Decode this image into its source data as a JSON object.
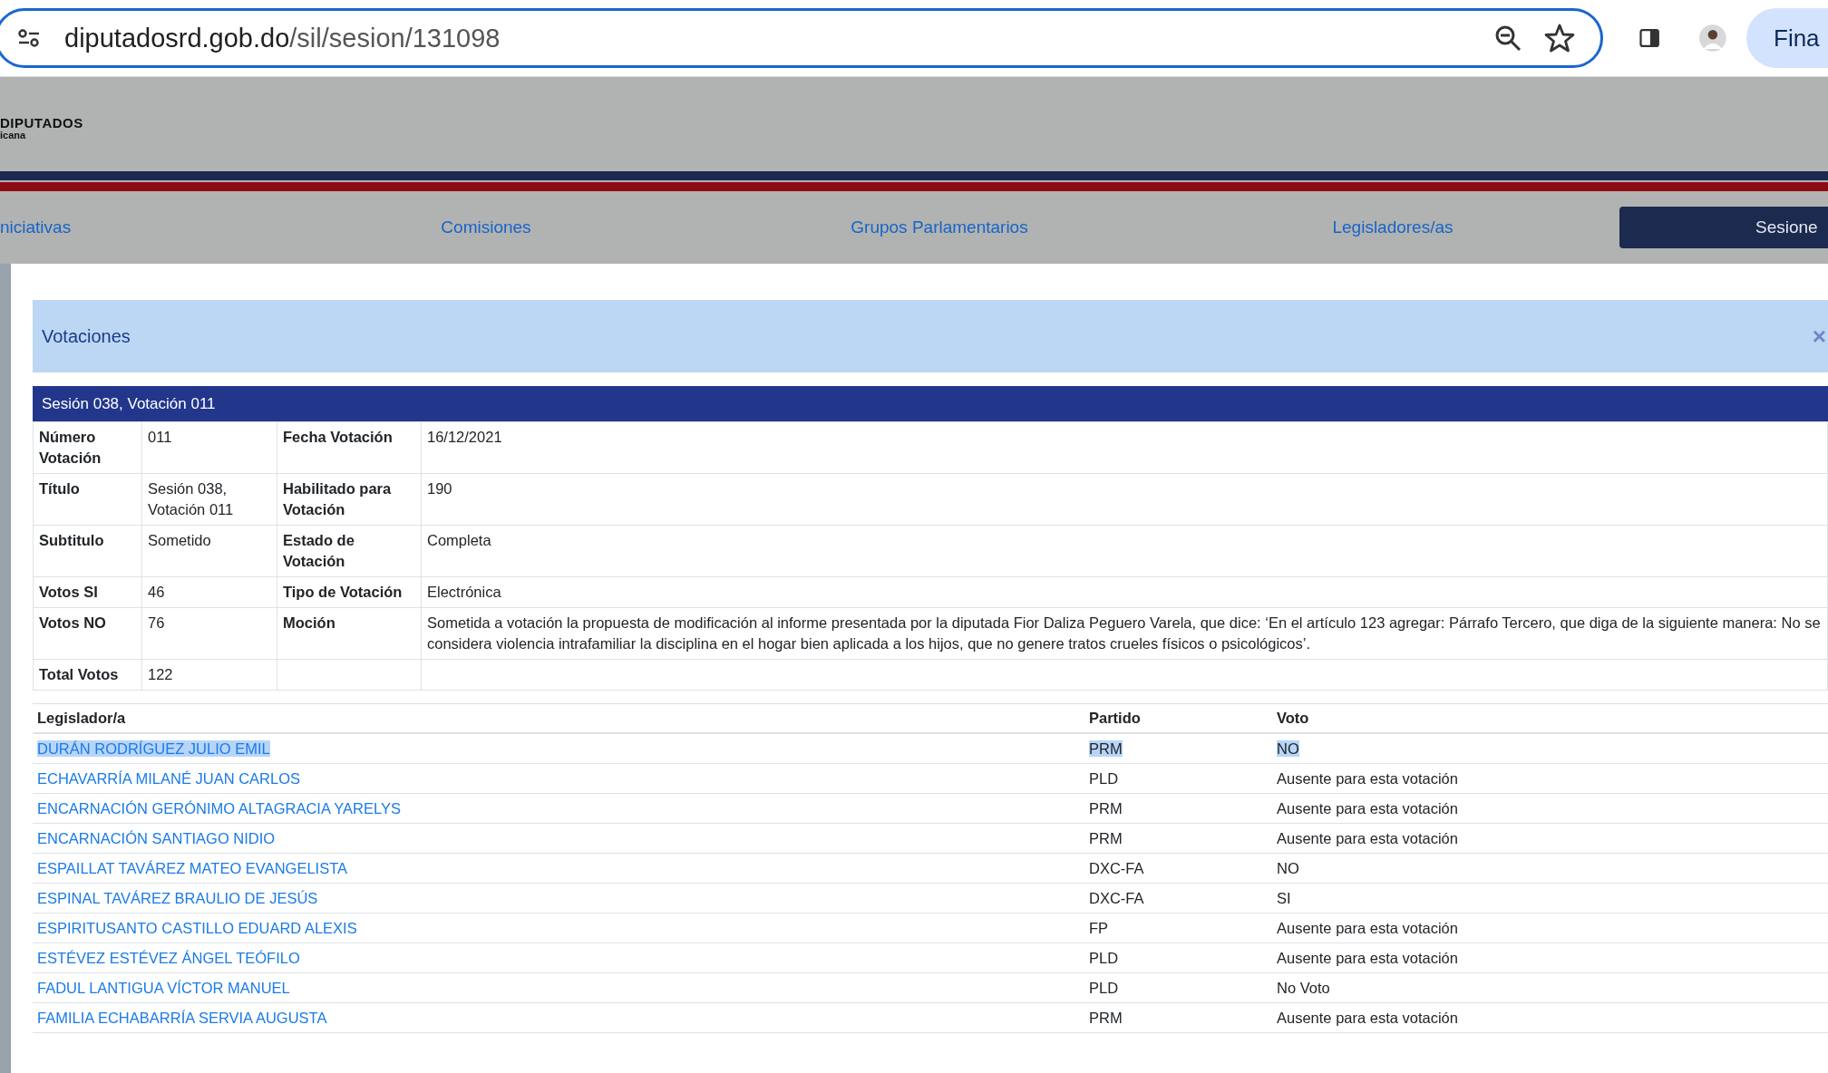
{
  "browser": {
    "url_host": "diputadosrd.gob.do",
    "url_path": "/sil/sesion/131098",
    "button": "Fina"
  },
  "header": {
    "logo_title": "DIPUTADOS",
    "logo_subtitle": "icana"
  },
  "nav": [
    {
      "label": "niciativas",
      "selected": false
    },
    {
      "label": "Comisiones",
      "selected": false
    },
    {
      "label": "Grupos Parlamentarios",
      "selected": false
    },
    {
      "label": "Legisladores/as",
      "selected": false
    },
    {
      "label": "Sesione",
      "selected": true
    }
  ],
  "modal": {
    "title": "Votaciones",
    "close": "×",
    "panel_title": "Sesión 038, Votación 011",
    "details": [
      {
        "label": "Número Votación",
        "value": "011",
        "label_2": "Fecha Votación",
        "value_2": "16/12/2021"
      },
      {
        "label": "Título",
        "value": "Sesión 038, Votación 011",
        "label_2": "Habilitado para Votación",
        "value_2": "190"
      },
      {
        "label": "Subtitulo",
        "value": "Sometido",
        "label_2": "Estado de Votación",
        "value_2": "Completa"
      },
      {
        "label": "Votos SI",
        "value": "46",
        "label_2": "Tipo de Votación",
        "value_2": "Electrónica"
      },
      {
        "label": "Votos NO",
        "value": "76",
        "label_2": "Moción",
        "value_2": "Sometida a votación la propuesta de modificación al informe presentada por la diputada Fior Daliza Peguero Varela, que dice: ‘En el artículo 123 agregar: Párrafo Tercero, que diga de la siguiente manera: No se considera violencia intrafamiliar la disciplina en el hogar bien aplicada a los hijos, que no genere tratos crueles físicos o psicológicos’."
      },
      {
        "label": "Total Votos",
        "value": "122"
      }
    ],
    "votes": {
      "columns": [
        "Legislador/a",
        "Partido",
        "Voto"
      ],
      "rows": [
        {
          "name": "DURÁN RODRÍGUEZ JULIO EMIL",
          "party": "PRM",
          "vote": "NO",
          "selected": true
        },
        {
          "name": "ECHAVARRÍA MILANÉ JUAN CARLOS",
          "party": "PLD",
          "vote": "Ausente para esta votación",
          "selected": false
        },
        {
          "name": "ENCARNACIÓN GERÓNIMO ALTAGRACIA YARELYS",
          "party": "PRM",
          "vote": "Ausente para esta votación",
          "selected": false
        },
        {
          "name": "ENCARNACIÓN SANTIAGO NIDIO",
          "party": "PRM",
          "vote": "Ausente para esta votación",
          "selected": false
        },
        {
          "name": "ESPAILLAT TAVÁREZ MATEO EVANGELISTA",
          "party": "DXC-FA",
          "vote": "NO",
          "selected": false
        },
        {
          "name": "ESPINAL TAVÁREZ BRAULIO DE JESÚS",
          "party": "DXC-FA",
          "vote": "SI",
          "selected": false
        },
        {
          "name": "ESPIRITUSANTO CASTILLO EDUARD ALEXIS",
          "party": "FP",
          "vote": "Ausente para esta votación",
          "selected": false
        },
        {
          "name": "ESTÉVEZ ESTÉVEZ ÁNGEL TEÓFILO",
          "party": "PLD",
          "vote": "Ausente para esta votación",
          "selected": false
        },
        {
          "name": "FADUL LANTIGUA VÍCTOR MANUEL",
          "party": "PLD",
          "vote": "No Voto",
          "selected": false
        },
        {
          "name": "FAMILIA ECHABARRÍA SERVIA AUGUSTA",
          "party": "PRM",
          "vote": "Ausente para esta votación",
          "selected": false
        }
      ]
    }
  }
}
